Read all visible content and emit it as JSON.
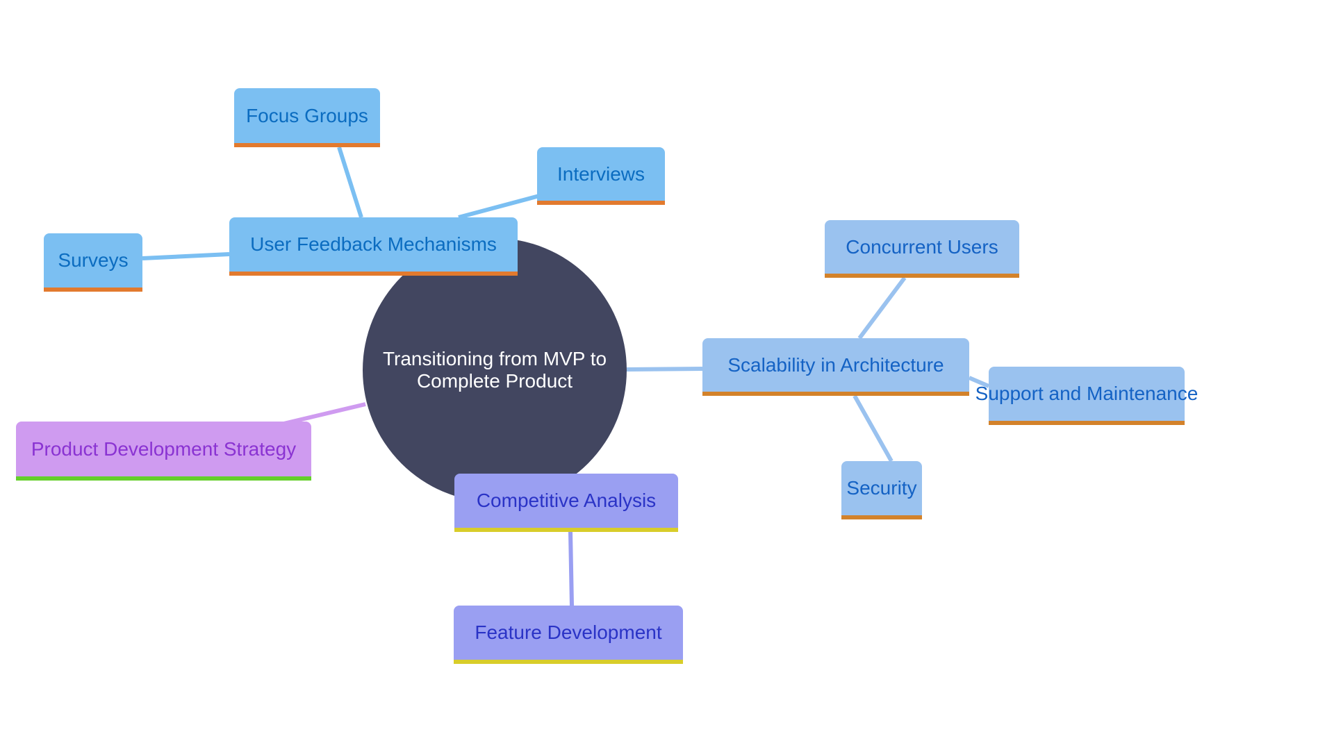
{
  "diagram": {
    "type": "mindmap",
    "root": {
      "label": "Transitioning from MVP to Complete Product",
      "label_lines": [
        "Transitioning from MVP to",
        "Complete Product"
      ],
      "fill": "#424660",
      "text_color": "#ffffff"
    },
    "branches": [
      {
        "id": "ufm",
        "label": "User Feedback Mechanisms",
        "fill": "#7BBFF2",
        "text_color": "#0B6CC0",
        "bar_color": "#E27A2E",
        "edge_color": "#7BBFF2",
        "children": [
          {
            "id": "fg",
            "label": "Focus Groups"
          },
          {
            "id": "iv",
            "label": "Interviews"
          },
          {
            "id": "sv",
            "label": "Surveys"
          }
        ]
      },
      {
        "id": "sia",
        "label": "Scalability in Architecture",
        "fill": "#9AC2EF",
        "text_color": "#1462C4",
        "bar_color": "#D3822A",
        "edge_color": "#9AC2EF",
        "children": [
          {
            "id": "cu",
            "label": "Concurrent Users"
          },
          {
            "id": "sm",
            "label": "Support and Maintenance"
          },
          {
            "id": "sec",
            "label": "Security"
          }
        ]
      },
      {
        "id": "pds",
        "label": "Product Development Strategy",
        "fill": "#CF9BF0",
        "text_color": "#8A33D2",
        "bar_color": "#64CF2A",
        "edge_color": "#CF9BF0",
        "children": []
      },
      {
        "id": "ca",
        "label": "Competitive Analysis",
        "fill": "#9A9FF2",
        "text_color": "#2A33C6",
        "bar_color": "#D8CD2A",
        "edge_color": "#9A9FF2",
        "children": [
          {
            "id": "fd",
            "label": "Feature Development"
          }
        ]
      }
    ]
  }
}
